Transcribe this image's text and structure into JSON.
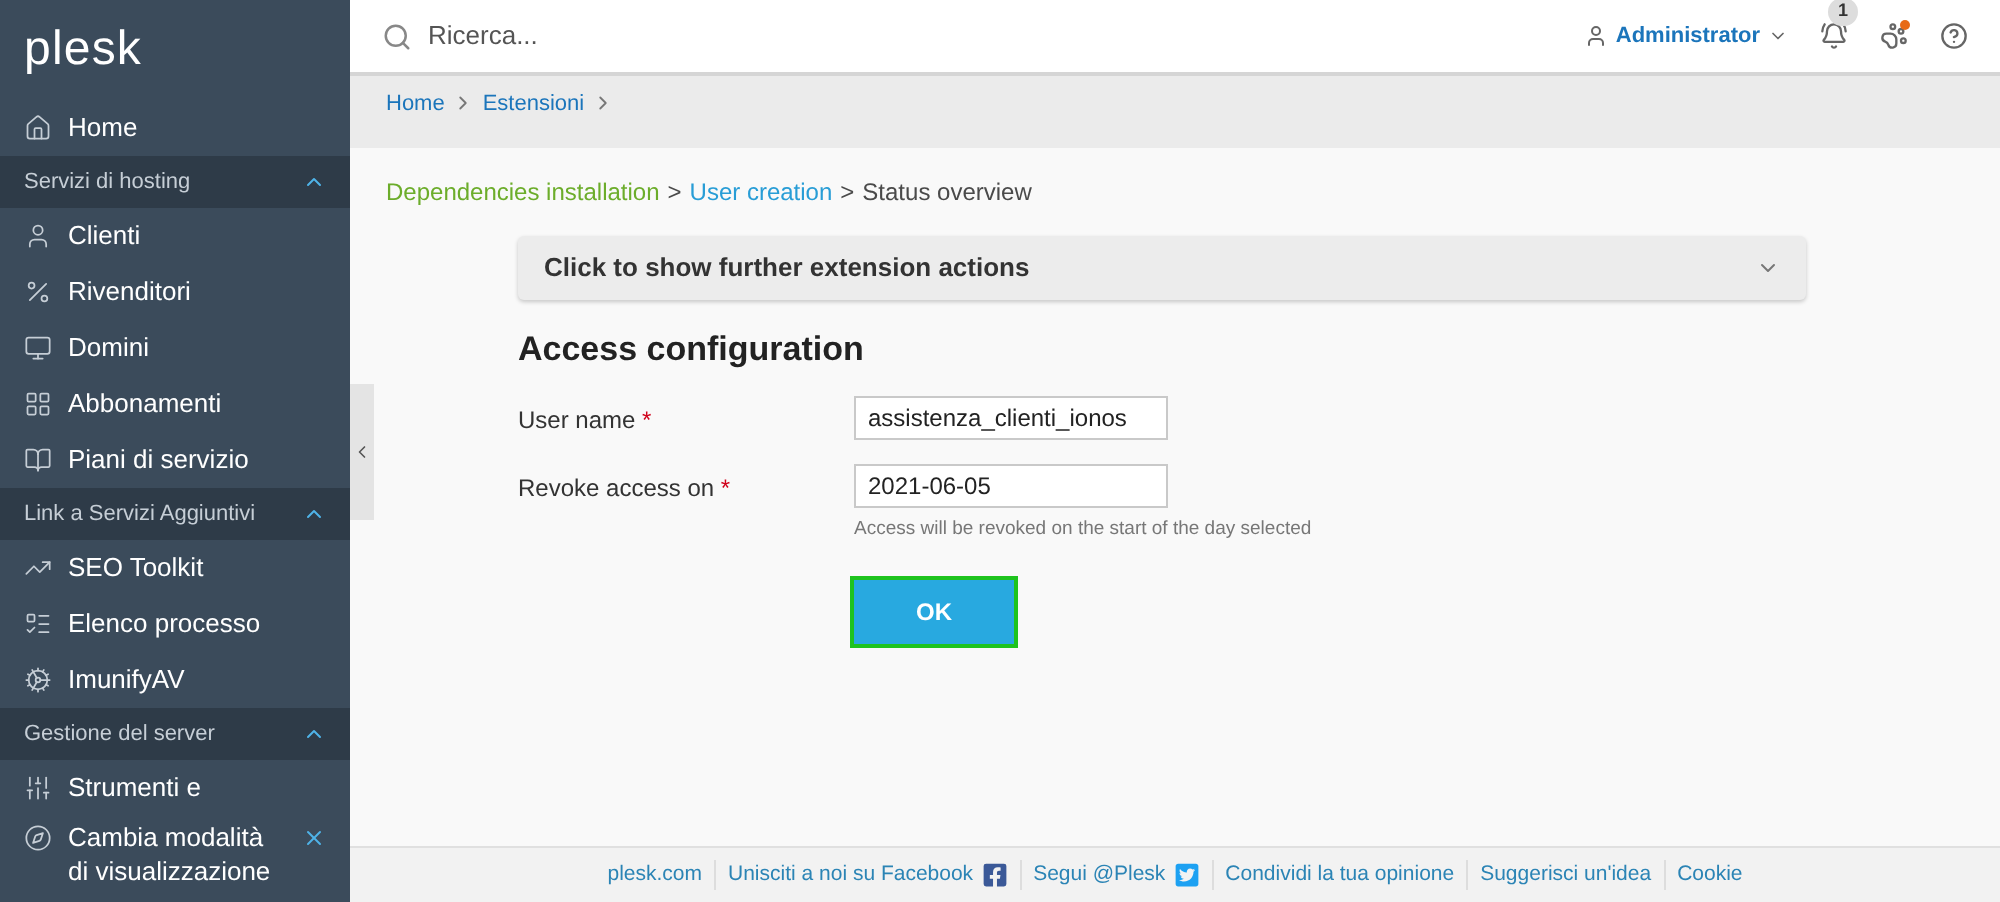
{
  "sidebar": {
    "logo": "plesk",
    "items": [
      {
        "kind": "item",
        "label": "Home"
      },
      {
        "kind": "section",
        "label": "Servizi di hosting",
        "expanded": true
      },
      {
        "kind": "item",
        "label": "Clienti"
      },
      {
        "kind": "item",
        "label": "Rivenditori"
      },
      {
        "kind": "item",
        "label": "Domini"
      },
      {
        "kind": "item",
        "label": "Abbonamenti"
      },
      {
        "kind": "item",
        "label": "Piani di servizio"
      },
      {
        "kind": "section",
        "label": "Link a Servizi Aggiuntivi",
        "expanded": true
      },
      {
        "kind": "item",
        "label": "SEO Toolkit"
      },
      {
        "kind": "item",
        "label": "Elenco processo"
      },
      {
        "kind": "item",
        "label": "ImunifyAV"
      },
      {
        "kind": "section",
        "label": "Gestione del server",
        "expanded": true
      },
      {
        "kind": "item",
        "label": "Strumenti e"
      }
    ],
    "footer_item": {
      "label": "Cambia modalità di visualizzazione"
    }
  },
  "header": {
    "search": {
      "placeholder": "Ricerca..."
    },
    "user": "Administrator",
    "notifications": "1"
  },
  "breadcrumbs": [
    "Home",
    "Estensioni"
  ],
  "wizard_steps": [
    {
      "kind": "done",
      "label": "Dependencies installation"
    },
    {
      "kind": "separator",
      "label": ">"
    },
    {
      "kind": "link",
      "label": "User creation"
    },
    {
      "kind": "separator",
      "label": ">"
    },
    {
      "kind": "current",
      "label": "Status overview"
    }
  ],
  "accordion": {
    "title": "Click to show further extension actions",
    "expanded": false
  },
  "form": {
    "title": "Access configuration",
    "fields": [
      {
        "label": "User name",
        "required": "*",
        "value": "assistenza_clienti_ionos"
      },
      {
        "label": "Revoke access on",
        "required": "*",
        "value": "2021-06-05",
        "hint": "Access will be revoked on the start of the day selected"
      }
    ],
    "submit": {
      "label": "OK",
      "focused": true
    }
  },
  "footer": [
    {
      "label": "plesk.com"
    },
    {
      "label": "Unisciti a noi su Facebook"
    },
    {
      "label": "Segui @Plesk"
    },
    {
      "label": "Condividi la tua opinione"
    },
    {
      "label": "Suggerisci un'idea"
    },
    {
      "label": "Cookie"
    }
  ]
}
